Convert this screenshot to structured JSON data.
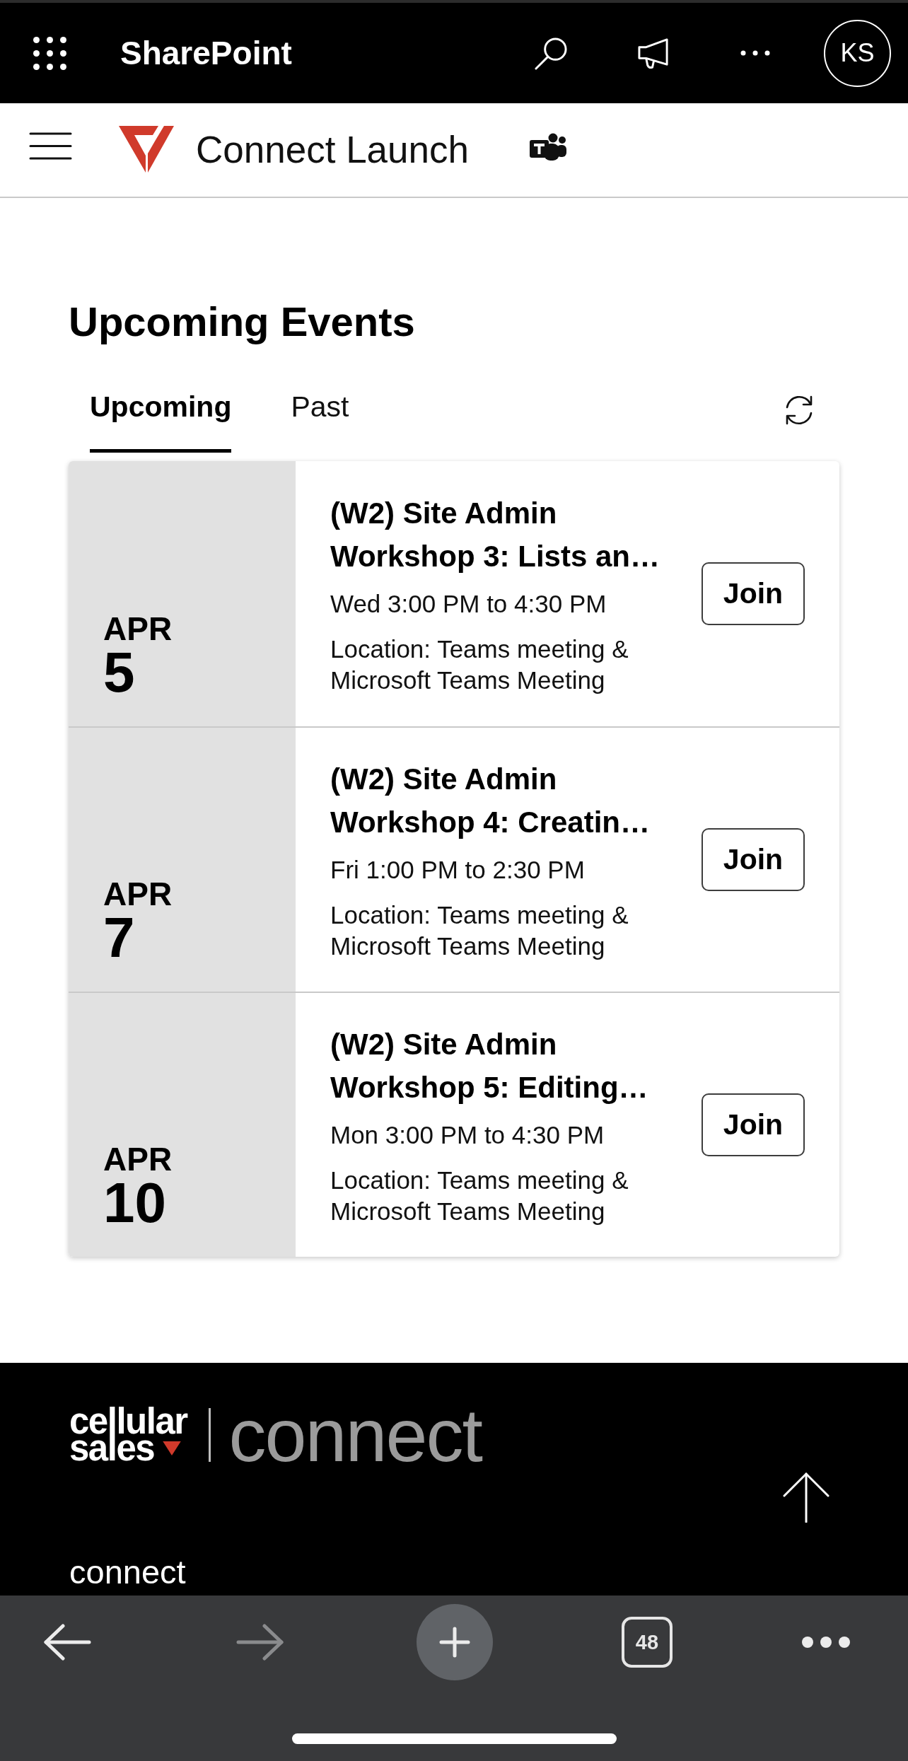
{
  "top_bar": {
    "app_name": "SharePoint",
    "avatar_initials": "KS"
  },
  "site_header": {
    "title": "Connect Launch"
  },
  "events_section": {
    "heading": "Upcoming Events",
    "tabs": [
      {
        "label": "Upcoming",
        "selected": true
      },
      {
        "label": "Past",
        "selected": false
      }
    ],
    "events": [
      {
        "month": "APR",
        "day": "5",
        "title": "(W2) Site Admin Workshop 3: Lists an…",
        "time": "Wed 3:00 PM to 4:30 PM",
        "location": "Location: Teams meeting & Microsoft Teams Meeting",
        "action": "Join"
      },
      {
        "month": "APR",
        "day": "7",
        "title": "(W2) Site Admin Workshop 4: Creatin…",
        "time": "Fri 1:00 PM to 2:30 PM",
        "location": "Location: Teams meeting & Microsoft Teams Meeting",
        "action": "Join"
      },
      {
        "month": "APR",
        "day": "10",
        "title": "(W2) Site Admin Workshop 5: Editing…",
        "time": "Mon 3:00 PM to 4:30 PM",
        "location": "Location: Teams meeting & Microsoft Teams Meeting",
        "action": "Join"
      }
    ]
  },
  "footer": {
    "logo_lines": [
      "cellular",
      "sales"
    ],
    "logo_product": "connect",
    "site_name": "connect"
  },
  "browser_toolbar": {
    "back": {
      "disabled": false
    },
    "forward": {
      "disabled": true
    },
    "tab_count": "48"
  }
}
